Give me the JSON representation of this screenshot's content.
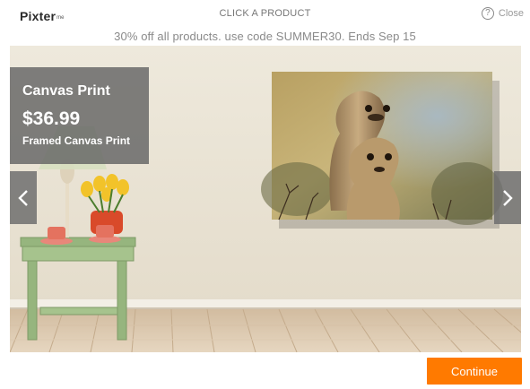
{
  "header": {
    "logo_text": "Pixter",
    "logo_suffix": "me",
    "title": "CLICK A PRODUCT",
    "close_label": "Close",
    "help_icon": "question-circle-icon",
    "help_glyph": "?"
  },
  "promo": {
    "text": "30% off all products. use code SUMMER30. Ends Sep 15"
  },
  "product": {
    "name": "Canvas Print",
    "price": "$36.99",
    "subtitle": "Framed Canvas Print"
  },
  "navigation": {
    "prev_icon": "chevron-left-icon",
    "next_icon": "chevron-right-icon"
  },
  "footer": {
    "continue_label": "Continue"
  },
  "colors": {
    "accent": "#ff7a00",
    "overlay": "#646464",
    "wall": "#ece6d8",
    "floor": "#d8c3a8"
  }
}
